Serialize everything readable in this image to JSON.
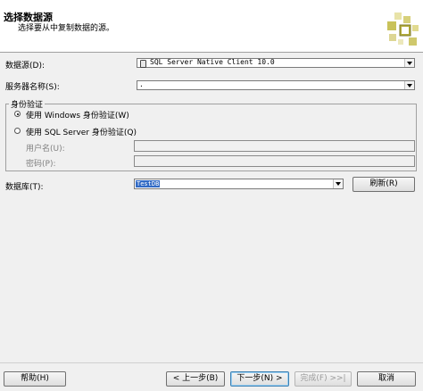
{
  "header": {
    "title": "选择数据源",
    "subtitle": "选择要从中复制数据的源。"
  },
  "data_source": {
    "label": "数据源(D):",
    "value": "SQL Server Native Client 10.0"
  },
  "server_name": {
    "label": "服务器名称(S):",
    "value": "."
  },
  "auth": {
    "legend": "身份验证",
    "windows_label": "使用 Windows 身份验证(W)",
    "sql_label": "使用 SQL Server 身份验证(Q)",
    "username_label": "用户名(U):",
    "password_label": "密码(P):",
    "username_value": "",
    "password_value": "",
    "selected": "windows"
  },
  "database": {
    "label": "数据库(T):",
    "value": "TestDB",
    "refresh_label": "刷新(R)"
  },
  "footer": {
    "help_label": "帮助(H)",
    "back_label": "< 上一步(B)",
    "next_label": "下一步(N) >",
    "finish_label": "完成(F) >>|",
    "cancel_label": "取消"
  }
}
